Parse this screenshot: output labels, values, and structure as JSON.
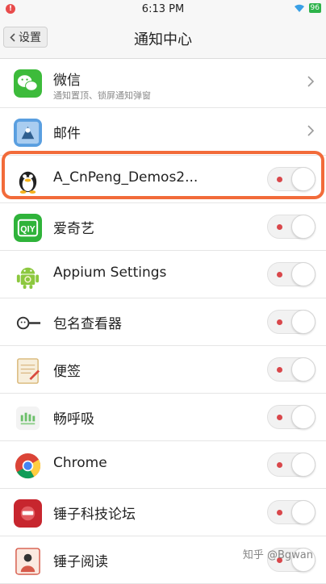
{
  "statusbar": {
    "time": "6:13 PM",
    "battery": "96"
  },
  "nav": {
    "back_label": "设置",
    "title": "通知中心"
  },
  "apps": [
    {
      "name": "微信",
      "subtitle": "通知置顶、锁屏通知弹窗",
      "control": "chevron",
      "icon": "wechat-icon"
    },
    {
      "name": "邮件",
      "subtitle": "",
      "control": "chevron",
      "icon": "mail-icon"
    },
    {
      "name": "A_CnPeng_Demos2...",
      "subtitle": "",
      "control": "toggle",
      "icon": "qq-penguin-icon"
    },
    {
      "name": "爱奇艺",
      "subtitle": "",
      "control": "toggle",
      "icon": "iqiyi-icon"
    },
    {
      "name": "Appium Settings",
      "subtitle": "",
      "control": "toggle",
      "icon": "android-icon"
    },
    {
      "name": "包名查看器",
      "subtitle": "",
      "control": "toggle",
      "icon": "magnifier-icon"
    },
    {
      "name": "便签",
      "subtitle": "",
      "control": "toggle",
      "icon": "notepad-icon"
    },
    {
      "name": "畅呼吸",
      "subtitle": "",
      "control": "toggle",
      "icon": "breath-icon"
    },
    {
      "name": "Chrome",
      "subtitle": "",
      "control": "toggle",
      "icon": "chrome-icon"
    },
    {
      "name": "锤子科技论坛",
      "subtitle": "",
      "control": "toggle",
      "icon": "smartisan-forum-icon"
    },
    {
      "name": "锤子阅读",
      "subtitle": "",
      "control": "toggle",
      "icon": "smartisan-reader-icon"
    }
  ],
  "watermark": "知乎 @Bgwan",
  "colors": {
    "highlight": "#f26b3a",
    "toggle_dot": "#d9474b",
    "battery": "#2db34a"
  }
}
